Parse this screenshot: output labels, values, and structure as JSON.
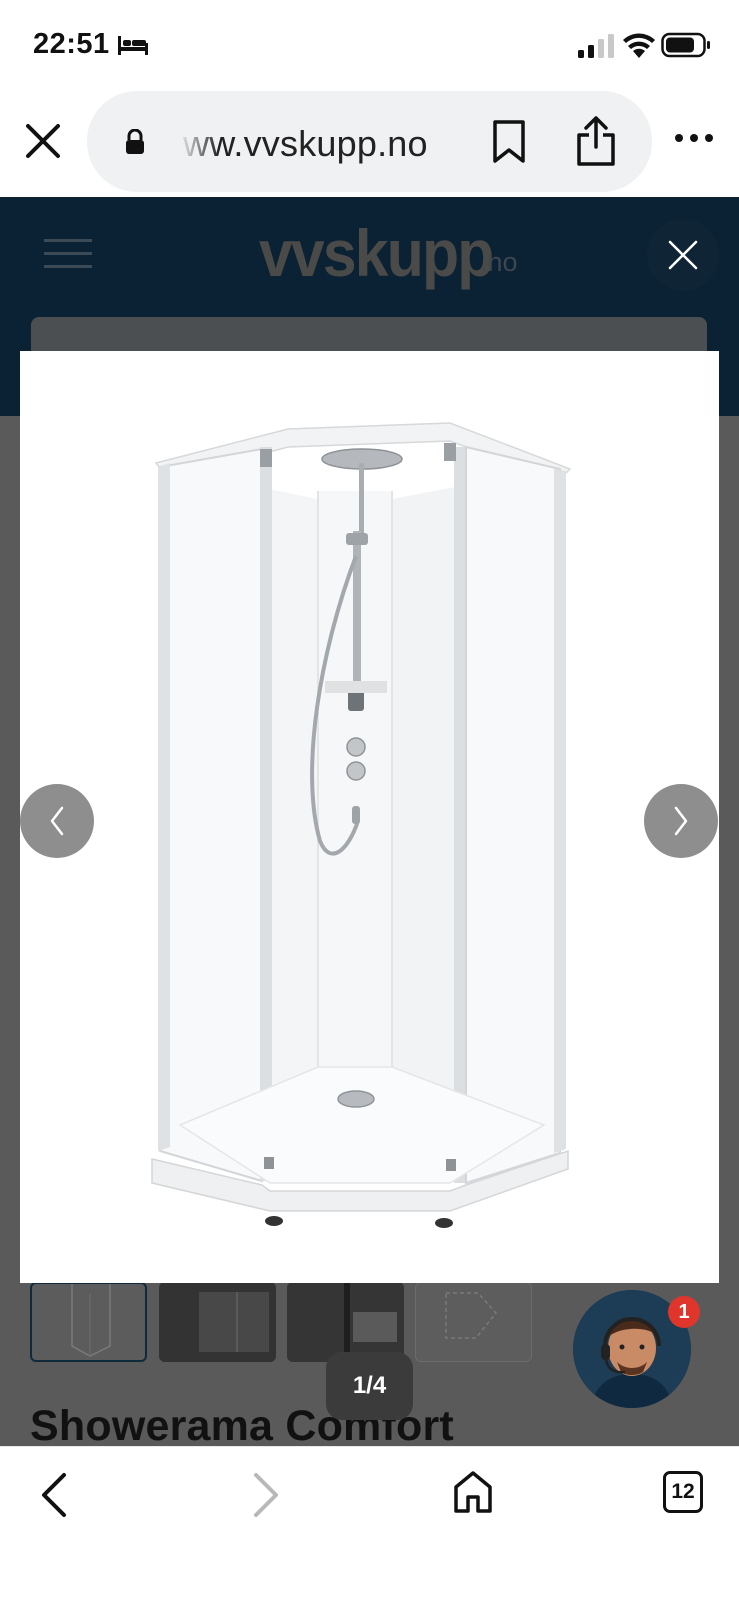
{
  "status_bar": {
    "time": "22:51",
    "icons": [
      "bed-icon",
      "signal-icon",
      "wifi-icon",
      "battery-icon"
    ]
  },
  "browser": {
    "url": "ww.vvskupp.no",
    "icons": [
      "close-icon",
      "lock-icon",
      "bookmark-icon",
      "share-icon",
      "more-icon"
    ]
  },
  "site": {
    "logo_main": "vvskupp",
    "logo_suffix": ".no",
    "header_color": "#0a2233",
    "icons": [
      "menu-icon",
      "cart-icon"
    ]
  },
  "lightbox": {
    "counter": "1/4",
    "current_image": 1,
    "total_images": 4,
    "icons": [
      "close-icon",
      "chevron-left-icon",
      "chevron-right-icon"
    ]
  },
  "product": {
    "title": "Showerama Comfort",
    "thumbnail_count": 4
  },
  "chat": {
    "badge_count": "1",
    "badge_color": "#e0352a"
  },
  "bottom_toolbar": {
    "tab_count": "12",
    "icons": [
      "back-icon",
      "forward-icon",
      "home-icon",
      "tabs-icon"
    ]
  }
}
